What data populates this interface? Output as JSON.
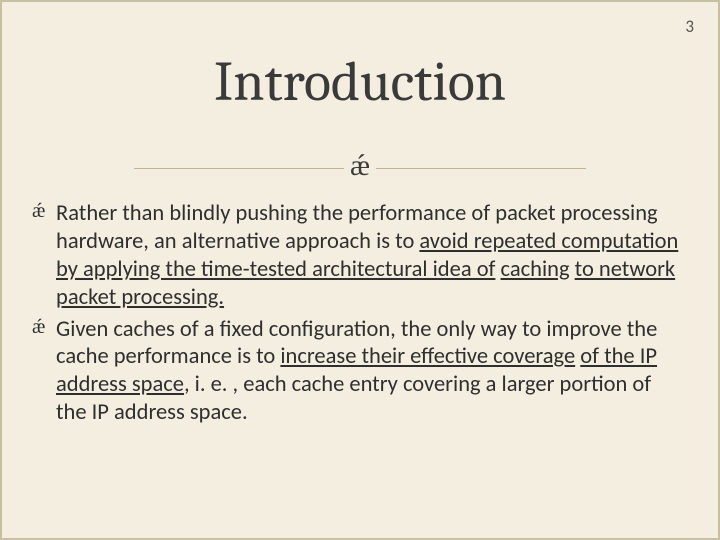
{
  "page_number": "3",
  "title": "Introduction",
  "ornament": "ǽ",
  "bullets": [
    {
      "pre": "Rather than blindly pushing the performance of packet processing hardware, an alternative approach is to ",
      "u1": "avoid repeated computation by applying the time-tested architectural idea of",
      "mid": " ",
      "u2": "caching",
      "mid2": " ",
      "u3": "to network packet processing.",
      "post": ""
    },
    {
      "pre": "Given caches of a fixed configuration, the only way to improve the cache performance is to ",
      "u1": "increase their effective coverage",
      "mid": " ",
      "u2": "of the IP address space",
      "mid2": ", i. e. , each cache entry covering a larger portion of the IP address space.",
      "u3": "",
      "post": ""
    }
  ]
}
